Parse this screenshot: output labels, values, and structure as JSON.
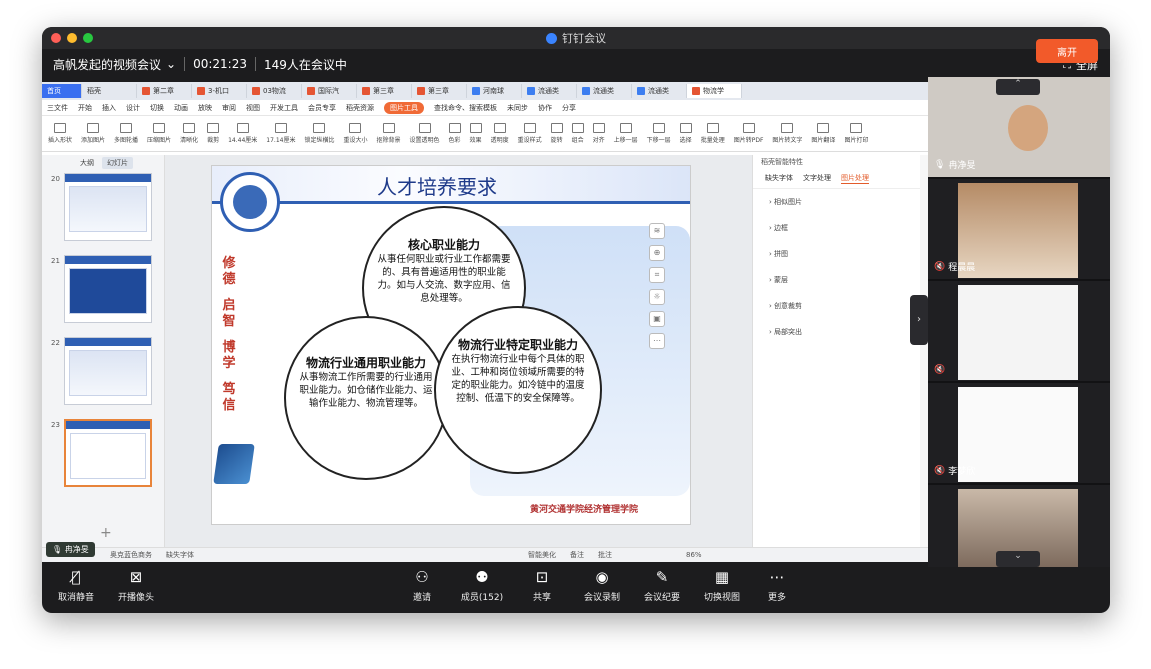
{
  "window": {
    "title": "钉钉会议",
    "meeting_name": "高帆发起的视频会议",
    "timer": "00:21:23",
    "count": "149人在会议中",
    "fullscreen": "全屏"
  },
  "wps": {
    "tabs": [
      "首页",
      "稻壳",
      "第二章",
      "3-机口",
      "03物流",
      "国际汽",
      "第三章",
      "第三章",
      "河南球",
      "流通类",
      "流通类",
      "流通类",
      "物流学"
    ],
    "menu": [
      "三文件",
      "开始",
      "插入",
      "设计",
      "切换",
      "动画",
      "放映",
      "审阅",
      "视图",
      "开发工具",
      "会员专享",
      "稻壳资源",
      "图片工具",
      "查找命令、搜索模板",
      "未同步",
      "协作",
      "分享"
    ],
    "ribbon": [
      "插入形状",
      "添加图片",
      "多图轮播",
      "压缩图片",
      "清晰化",
      "裁剪",
      "14.44厘米",
      "17.14厘米",
      "锁定纵横比",
      "重设大小",
      "抠除背景",
      "设置透明色",
      "色彩",
      "效果",
      "透明度",
      "重设样式",
      "旋转",
      "组合",
      "对齐",
      "上移一层",
      "下移一层",
      "选择",
      "批量处理",
      "图片转PDF",
      "图片转文字",
      "图片翻译",
      "图片打印"
    ],
    "thumb_tabs": [
      "大纲",
      "幻灯片"
    ],
    "slide_nums": [
      "20",
      "21",
      "22",
      "23"
    ],
    "panel": {
      "header": "稻壳智能特性",
      "tabs": [
        "缺失字体",
        "文字处理",
        "图片处理"
      ],
      "items": [
        "相似图片",
        "边框",
        "拼图",
        "蒙层",
        "创意裁剪",
        "局部突出"
      ]
    },
    "status": [
      "缺失字体",
      "智能美化",
      "备注",
      "批注",
      "86%"
    ],
    "theme": "奥克蓝色商务"
  },
  "slide": {
    "title": "人才培养要求",
    "motto": [
      "修",
      "德",
      "启",
      "智",
      "博",
      "学",
      "笃",
      "信"
    ],
    "footer": "黄河交通学院经济管理学院",
    "circles": [
      {
        "title": "核心职业能力",
        "text": "从事任何职业或行业工作都需要的、具有普遍适用性的职业能力。如与人交流、数字应用、信息处理等。"
      },
      {
        "title": "物流行业通用职业能力",
        "text": "从事物流工作所需要的行业通用职业能力。如仓储作业能力、运输作业能力、物流管理等。"
      },
      {
        "title": "物流行业特定职业能力",
        "text": "在执行物流行业中每个具体的职业、工种和岗位领域所需要的特定的职业能力。如冷链中的温度控制、低温下的安全保障等。"
      }
    ]
  },
  "participants": [
    "冉净旻",
    "程晨晨",
    "",
    "李梦欣",
    ""
  ],
  "self_label": "冉净旻",
  "controls": [
    {
      "icon": "mic-muted-icon",
      "label": "取消静音"
    },
    {
      "icon": "camera-icon",
      "label": "开播像头"
    },
    {
      "icon": "invite-icon",
      "label": "邀请"
    },
    {
      "icon": "members-icon",
      "label": "成员(152)"
    },
    {
      "icon": "share-icon",
      "label": "共享"
    },
    {
      "icon": "record-icon",
      "label": "会议录制"
    },
    {
      "icon": "minutes-icon",
      "label": "会议纪要"
    },
    {
      "icon": "view-icon",
      "label": "切换视图"
    },
    {
      "icon": "more-icon",
      "label": "更多"
    }
  ],
  "leave": "离开",
  "colors": {
    "accent": "#f25a2a",
    "wps_blue": "#3a6ff0"
  }
}
